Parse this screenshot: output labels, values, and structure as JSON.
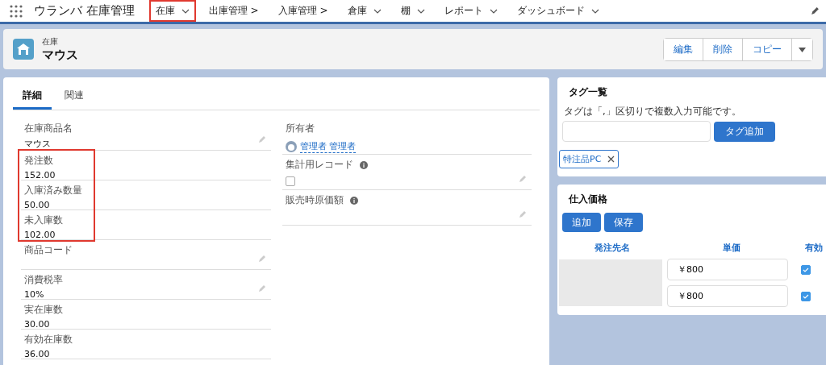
{
  "app": {
    "title": "ウランバ 在庫管理"
  },
  "nav": [
    {
      "label": "在庫",
      "dropdown": true,
      "highlighted": true
    },
    {
      "label": "出庫管理 >",
      "dropdown": false,
      "highlighted": false
    },
    {
      "label": "入庫管理 >",
      "dropdown": false,
      "highlighted": false
    },
    {
      "label": "倉庫",
      "dropdown": true,
      "highlighted": false
    },
    {
      "label": "棚",
      "dropdown": true,
      "highlighted": false
    },
    {
      "label": "レポート",
      "dropdown": true,
      "highlighted": false
    },
    {
      "label": "ダッシュボード",
      "dropdown": true,
      "highlighted": false
    }
  ],
  "record": {
    "object": "在庫",
    "name": "マウス",
    "actions": [
      "編集",
      "削除",
      "コピー"
    ]
  },
  "tabs": [
    {
      "label": "詳細",
      "selected": true
    },
    {
      "label": "関連",
      "selected": false
    }
  ],
  "left_fields": [
    {
      "highlighted": false,
      "fields": [
        {
          "label": "在庫商品名",
          "value": "マウス",
          "editable": true
        }
      ]
    },
    {
      "highlighted": true,
      "fields": [
        {
          "label": "発注数",
          "value": "152.00",
          "editable": false
        },
        {
          "label": "入庫済み数量",
          "value": "50.00",
          "editable": false
        },
        {
          "label": "未入庫数",
          "value": "102.00",
          "editable": false
        }
      ]
    },
    {
      "highlighted": false,
      "fields": [
        {
          "label": "商品コード",
          "editable": true
        },
        {
          "label": "消費税率",
          "value": "10%",
          "editable": true
        },
        {
          "label": "実在庫数",
          "value": "30.00",
          "editable": false
        },
        {
          "label": "有効在庫数",
          "value": "36.00",
          "editable": false
        }
      ]
    }
  ],
  "right_fields": [
    {
      "label": "所有者",
      "kind": "link",
      "value": "管理者 管理者",
      "info": false
    },
    {
      "label": "集計用レコード",
      "kind": "checkbox",
      "checked": false,
      "info": true
    },
    {
      "label": "販売時原価額",
      "kind": "text",
      "info": true
    }
  ],
  "tags": {
    "title": "タグ一覧",
    "hint": "タグは「,」区切りで複数入力可能です。",
    "button": "タグ追加",
    "items": [
      "特注品PC"
    ]
  },
  "prices": {
    "title": "仕入価格",
    "buttons": [
      "追加",
      "保存"
    ],
    "columns": [
      "発注先名",
      "単価",
      "有効"
    ],
    "rows": [
      {
        "price": "￥800",
        "active": true
      },
      {
        "price": "￥800",
        "active": true
      }
    ]
  }
}
